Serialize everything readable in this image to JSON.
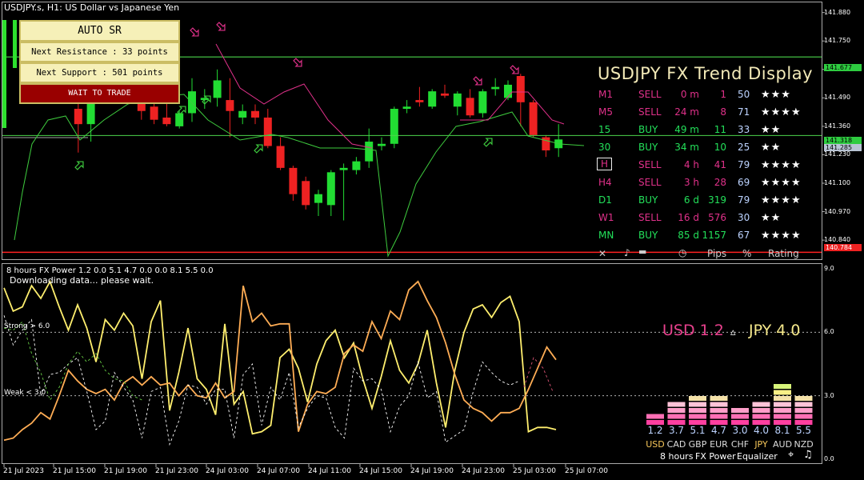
{
  "chart_title": "USDJPY.s, H1:  US Dollar vs Japanese Yen",
  "auto_sr": {
    "title": "AUTO SR",
    "resistance": "Next Resistance : 33 points",
    "support": "Next Support : 501 points",
    "status": "WAIT TO TRADE"
  },
  "trend_display": {
    "title": "USDJPY FX Trend Display",
    "rows": [
      {
        "tf": "M1",
        "signal": "SELL",
        "age": "0 m",
        "pips": "1",
        "pct": "50",
        "stars": "★★★"
      },
      {
        "tf": "M5",
        "signal": "SELL",
        "age": "24 m",
        "pips": "8",
        "pct": "71",
        "stars": "★★★★"
      },
      {
        "tf": "15",
        "signal": "BUY",
        "age": "49 m",
        "pips": "11",
        "pct": "33",
        "stars": "★★"
      },
      {
        "tf": "30",
        "signal": "BUY",
        "age": "34 m",
        "pips": "10",
        "pct": "25",
        "stars": "★★"
      },
      {
        "tf": "H",
        "signal": "SELL",
        "age": "4 h",
        "pips": "41",
        "pct": "79",
        "stars": "★★★★"
      },
      {
        "tf": "H4",
        "signal": "SELL",
        "age": "3 h",
        "pips": "28",
        "pct": "69",
        "stars": "★★★★"
      },
      {
        "tf": "D1",
        "signal": "BUY",
        "age": "6 d",
        "pips": "319",
        "pct": "79",
        "stars": "★★★★"
      },
      {
        "tf": "W1",
        "signal": "SELL",
        "age": "16 d",
        "pips": "576",
        "pct": "30",
        "stars": "★★"
      },
      {
        "tf": "MN",
        "signal": "BUY",
        "age": "85 d",
        "pips": "1157",
        "pct": "67",
        "stars": "★★★★"
      }
    ],
    "footer": {
      "close": "✕",
      "sound": "♪",
      "clock": "◷",
      "pips": "Pips",
      "pct": "%",
      "rating": "Rating"
    },
    "colors": {
      "buy": "#23e05a",
      "sell": "#e0318a",
      "selected_tf": "H"
    }
  },
  "price_axis": [
    "141.880",
    "141.750",
    "141.620",
    "141.490",
    "141.360",
    "141.230",
    "141.100",
    "140.970",
    "140.840"
  ],
  "price_badges": {
    "resistance": "141.677",
    "bid": "141.318",
    "ask": "141.285",
    "support": "140.784"
  },
  "time_axis": [
    "21 Jul 2023",
    "21 Jul 15:00",
    "21 Jul 19:00",
    "21 Jul 23:00",
    "24 Jul 03:00",
    "24 Jul 07:00",
    "24 Jul 11:00",
    "24 Jul 15:00",
    "24 Jul 19:00",
    "24 Jul 23:00",
    "25 Jul 03:00",
    "25 Jul 07:00"
  ],
  "indicator": {
    "title": "8 hours FX Power 1.2 0.0 5.1 4.7 0.0 0.0 8.1 5.5 0.0",
    "status": "Downloading data... please wait.",
    "strong_label": "Strong > 6.0",
    "weak_label": "Weak < 3.0",
    "axis": [
      "9.0",
      "6.0",
      "3.0",
      "0.0"
    ],
    "pair_left": "USD 1.2",
    "pair_arrow": "▵",
    "pair_right": "JPY 4.0",
    "footer": {
      "period": "8 hours",
      "name": "FX Power",
      "eq": "Equalizer",
      "cross": "⌖",
      "note": "♫"
    }
  },
  "equalizer": [
    {
      "cur": "USD",
      "val": "1.2",
      "value": 1.2,
      "color": "#f7c75a"
    },
    {
      "cur": "CAD",
      "val": "3.7",
      "value": 3.7,
      "color": "#ddd"
    },
    {
      "cur": "GBP",
      "val": "5.1",
      "value": 5.1,
      "color": "#ddd"
    },
    {
      "cur": "EUR",
      "val": "4.7",
      "value": 4.7,
      "color": "#ddd"
    },
    {
      "cur": "CHF",
      "val": "3.0",
      "value": 3.0,
      "color": "#ddd"
    },
    {
      "cur": "JPY",
      "val": "4.0",
      "value": 4.0,
      "color": "#f7c75a"
    },
    {
      "cur": "AUD",
      "val": "8.1",
      "value": 8.1,
      "color": "#ddd"
    },
    {
      "cur": "NZD",
      "val": "5.5",
      "value": 5.5,
      "color": "#ddd"
    }
  ],
  "chart_data": {
    "type": "candlestick",
    "symbol": "USDJPY.s",
    "timeframe": "H1",
    "ylim": [
      140.76,
      141.93
    ],
    "resistance": 141.677,
    "support": 140.784,
    "bid": 141.318,
    "ask": 141.285,
    "candles": [
      {
        "o": 141.7,
        "h": 141.74,
        "l": 141.55,
        "c": 141.58
      },
      {
        "o": 141.44,
        "h": 141.56,
        "l": 141.24,
        "c": 141.37
      },
      {
        "o": 141.37,
        "h": 141.57,
        "l": 141.29,
        "c": 141.49
      },
      {
        "o": 141.66,
        "h": 141.73,
        "l": 141.58,
        "c": 141.68
      },
      {
        "o": 141.71,
        "h": 141.77,
        "l": 141.65,
        "c": 141.72
      },
      {
        "o": 141.72,
        "h": 141.8,
        "l": 141.62,
        "c": 141.66
      },
      {
        "o": 141.63,
        "h": 141.67,
        "l": 141.39,
        "c": 141.43
      },
      {
        "o": 141.45,
        "h": 141.52,
        "l": 141.37,
        "c": 141.39
      },
      {
        "o": 141.4,
        "h": 141.5,
        "l": 141.36,
        "c": 141.37
      },
      {
        "o": 141.36,
        "h": 141.43,
        "l": 141.35,
        "c": 141.42
      },
      {
        "o": 141.42,
        "h": 141.58,
        "l": 141.38,
        "c": 141.52
      },
      {
        "o": 141.48,
        "h": 141.53,
        "l": 141.44,
        "c": 141.49
      },
      {
        "o": 141.49,
        "h": 141.62,
        "l": 141.45,
        "c": 141.57
      },
      {
        "o": 141.48,
        "h": 141.58,
        "l": 141.31,
        "c": 141.43
      },
      {
        "o": 141.4,
        "h": 141.46,
        "l": 141.37,
        "c": 141.43
      },
      {
        "o": 141.43,
        "h": 141.46,
        "l": 141.37,
        "c": 141.4
      },
      {
        "o": 141.4,
        "h": 141.44,
        "l": 141.26,
        "c": 141.27
      },
      {
        "o": 141.27,
        "h": 141.31,
        "l": 141.16,
        "c": 141.17
      },
      {
        "o": 141.17,
        "h": 141.18,
        "l": 141.02,
        "c": 141.05
      },
      {
        "o": 141.11,
        "h": 141.13,
        "l": 140.98,
        "c": 141.0
      },
      {
        "o": 141.01,
        "h": 141.07,
        "l": 140.95,
        "c": 141.05
      },
      {
        "o": 141.0,
        "h": 141.16,
        "l": 140.95,
        "c": 141.15
      },
      {
        "o": 141.16,
        "h": 141.19,
        "l": 140.93,
        "c": 141.17
      },
      {
        "o": 141.16,
        "h": 141.22,
        "l": 141.14,
        "c": 141.2
      },
      {
        "o": 141.2,
        "h": 141.35,
        "l": 141.17,
        "c": 141.29
      },
      {
        "o": 141.27,
        "h": 141.31,
        "l": 141.25,
        "c": 141.28
      },
      {
        "o": 141.28,
        "h": 141.45,
        "l": 141.26,
        "c": 141.44
      },
      {
        "o": 141.44,
        "h": 141.48,
        "l": 141.42,
        "c": 141.45
      },
      {
        "o": 141.48,
        "h": 141.54,
        "l": 141.45,
        "c": 141.47
      },
      {
        "o": 141.45,
        "h": 141.53,
        "l": 141.44,
        "c": 141.52
      },
      {
        "o": 141.51,
        "h": 141.55,
        "l": 141.49,
        "c": 141.5
      },
      {
        "o": 141.45,
        "h": 141.52,
        "l": 141.41,
        "c": 141.51
      },
      {
        "o": 141.49,
        "h": 141.53,
        "l": 141.4,
        "c": 141.41
      },
      {
        "o": 141.42,
        "h": 141.53,
        "l": 141.4,
        "c": 141.52
      },
      {
        "o": 141.53,
        "h": 141.58,
        "l": 141.5,
        "c": 141.54
      },
      {
        "o": 141.49,
        "h": 141.57,
        "l": 141.48,
        "c": 141.55
      },
      {
        "o": 141.59,
        "h": 141.6,
        "l": 141.36,
        "c": 141.47
      },
      {
        "o": 141.47,
        "h": 141.48,
        "l": 141.31,
        "c": 141.32
      },
      {
        "o": 141.31,
        "h": 141.32,
        "l": 141.22,
        "c": 141.25
      },
      {
        "o": 141.26,
        "h": 141.37,
        "l": 141.22,
        "c": 141.3
      }
    ]
  },
  "indicator_data": {
    "type": "line",
    "ylim": [
      0,
      9
    ],
    "strong": 6.0,
    "weak": 3.0,
    "series": [
      {
        "color": "#ffef6e",
        "dash": false,
        "values": [
          8.1,
          7.0,
          7.2,
          8.2,
          7.6,
          8.4,
          7.2,
          6.1,
          7.3,
          6.2,
          4.6,
          6.6,
          6.1,
          6.9,
          6.3,
          3.8,
          6.5,
          7.5,
          2.3,
          4.1,
          6.2,
          3.8,
          3.3,
          2.1,
          6.4,
          2.6,
          3.2,
          1.2,
          1.3,
          1.6,
          4.8,
          5.2,
          4.3,
          2.7,
          4.5,
          5.6,
          6.1,
          4.8,
          5.5,
          3.8,
          2.4,
          3.9,
          5.6,
          4.2,
          3.6,
          4.5,
          6.1,
          3.6,
          1.5,
          4.2,
          6.0,
          7.1,
          7.3,
          6.7,
          7.4,
          7.7,
          6.5,
          1.3,
          1.5,
          1.5,
          1.4
        ]
      },
      {
        "color": "#ffad55",
        "dash": false,
        "values": [
          0.9,
          1.0,
          1.4,
          1.7,
          2.2,
          1.9,
          3.0,
          4.2,
          3.7,
          3.3,
          3.1,
          3.3,
          2.8,
          3.6,
          3.9,
          3.5,
          3.9,
          3.5,
          3.6,
          3.0,
          3.5,
          3.0,
          2.9,
          3.6,
          2.9,
          3.2,
          8.2,
          6.5,
          6.9,
          6.3,
          6.4,
          6.4,
          1.3,
          2.6,
          3.2,
          3.1,
          3.4,
          5.0,
          5.4,
          5.1,
          6.5,
          5.7,
          7.0,
          6.6,
          8.0,
          8.4,
          7.5,
          6.7,
          5.5,
          4.0,
          2.8,
          2.4,
          2.2,
          1.8,
          2.2,
          2.2,
          2.4,
          3.3,
          4.3,
          5.3,
          4.7
        ]
      },
      {
        "color": "#ffffff",
        "dash": true,
        "values": [
          6.8,
          5.4,
          6.1,
          6.6,
          3.0,
          4.0,
          4.1,
          4.5,
          4.8,
          3.2,
          1.4,
          1.8,
          4.1,
          3.4,
          2.8,
          1.0,
          3.2,
          3.4,
          0.7,
          1.8,
          3.5,
          3.4,
          2.6,
          3.3,
          3.3,
          1.0,
          4.0,
          4.5,
          1.6,
          3.4,
          2.8,
          4.1,
          1.5,
          2.4,
          3.0,
          2.9,
          1.5,
          1.0,
          4.3,
          3.7,
          3.8,
          3.3,
          1.3,
          2.5,
          3.0,
          4.6,
          2.9,
          3.2,
          0.8,
          1.1,
          1.4,
          3.2,
          4.6,
          4.1,
          3.7,
          3.5,
          3.7
        ]
      },
      {
        "color": "#66cc44",
        "dash": true,
        "values": [
          6.2,
          6.1,
          6.5,
          5.0,
          4.1,
          2.8,
          3.4,
          4.5,
          5.1,
          4.6,
          5.0,
          4.2,
          3.8,
          3.7,
          3.0,
          2.8
        ]
      },
      {
        "color": "#dd5577",
        "dash": true,
        "values": [
          3.4,
          4.8,
          4.3,
          3.2
        ]
      }
    ]
  }
}
